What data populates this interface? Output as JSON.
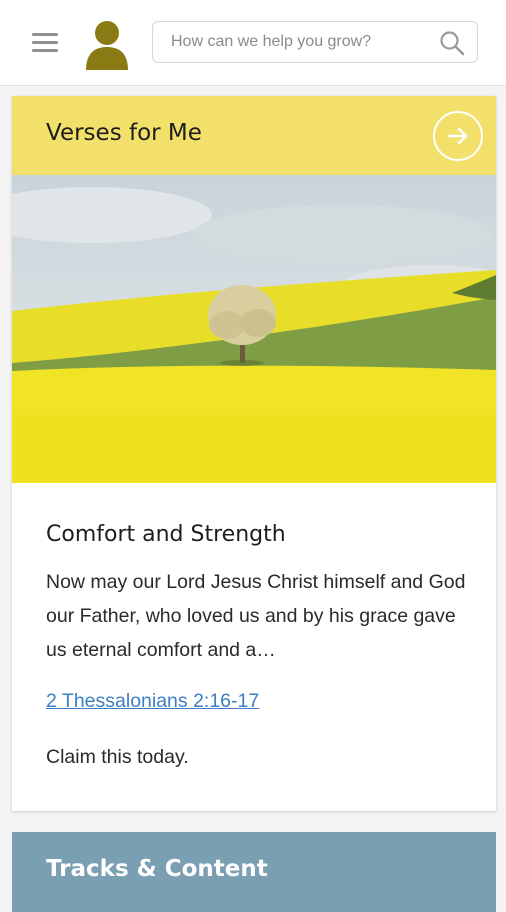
{
  "header": {
    "search_placeholder": "How can we help you grow?",
    "icons": [
      "menu-icon",
      "avatar-icon",
      "search-icon"
    ]
  },
  "verses_card": {
    "title": "Verses for Me",
    "header_color": "#f2e06a",
    "verse_title": "Comfort and Strength",
    "verse_text": "Now may our Lord Jesus Christ himself and God our Father, who loved us and by his grace gave us eternal comfort and a…",
    "reference": "2 Thessalonians 2:16-17",
    "cta": "Claim this today."
  },
  "tracks_card": {
    "title": "Tracks & Content",
    "header_color": "#7b9fb2"
  }
}
